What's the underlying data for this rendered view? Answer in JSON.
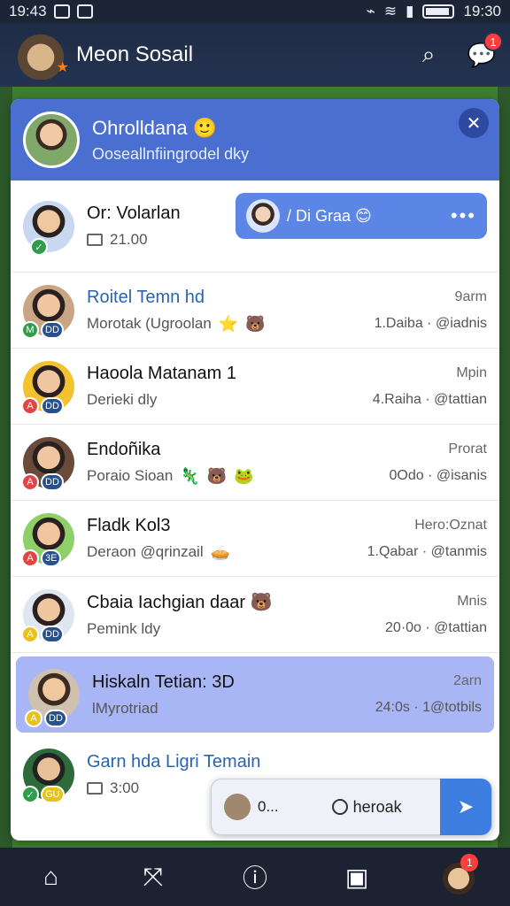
{
  "status_bar": {
    "time_left": "19:43",
    "time_right": "19:30"
  },
  "app": {
    "title": "Meon Sosail",
    "notification_count": "1"
  },
  "panel": {
    "header_name": "Ohrolldana 🙂",
    "header_subtitle": "Ooseallnfiingrodel dky"
  },
  "first_contact": {
    "name": "Or: Volarlan",
    "sub": "21.00",
    "bubble_text": "/ Di Graa 😊"
  },
  "contacts": [
    {
      "name": "Roitel Temn hd",
      "sub": "Morotak (Ugroolan",
      "emojis": [
        "⭐",
        "🐻"
      ],
      "time": "9arm",
      "detail": "1.Daiba · @iadnis",
      "badges": [
        "rb-green",
        "rb-blue"
      ],
      "badge_labels": [
        "M",
        "DD"
      ]
    },
    {
      "name": "Haoola Matanam 1",
      "sub": "Derieki dly",
      "emojis": [],
      "time": "Mpin",
      "detail": "4.Raiha · @tattian",
      "badges": [
        "rb-red",
        "rb-blue"
      ],
      "badge_labels": [
        "A",
        "DD"
      ]
    },
    {
      "name": "Endoñika",
      "sub": "Poraio Sioan",
      "emojis": [
        "🦎",
        "🐻",
        "🐸"
      ],
      "time": "Prorat",
      "detail": "0Odo · @isanis",
      "badges": [
        "rb-red",
        "rb-blue"
      ],
      "badge_labels": [
        "A",
        "DD"
      ]
    },
    {
      "name": "Fladk Kol3",
      "sub": "Deraon @qrinzail",
      "emojis": [
        "🥧"
      ],
      "time": "Hero:Oznat",
      "detail": "1.Qabar · @tanmis",
      "badges": [
        "rb-red",
        "rb-blue"
      ],
      "badge_labels": [
        "A",
        "3E"
      ]
    },
    {
      "name": "Cbaia Iachgian daar 🐻",
      "sub": "Pemink ldy",
      "emojis": [],
      "time": "Mnis",
      "detail": "20·0o · @tattian",
      "badges": [
        "rb-yellow",
        "rb-blue"
      ],
      "badge_labels": [
        "A",
        "DD"
      ]
    }
  ],
  "selected_contact": {
    "name": "Hiskaln Tetian: 3D",
    "sub": "lMyrotriad",
    "time": "2arn",
    "detail": "24:0s · 1@totbils"
  },
  "last_contact": {
    "name": "Garn hda Ligri Temain",
    "sub": "3:00"
  },
  "composer": {
    "text": "0...",
    "action_label": "heroak"
  },
  "bottom_nav": {
    "badge": "1"
  },
  "colors": {
    "header_blue": "#4a6fd0",
    "selected_row": "#a9b6f5",
    "bubble_blue": "#5b86e5"
  }
}
